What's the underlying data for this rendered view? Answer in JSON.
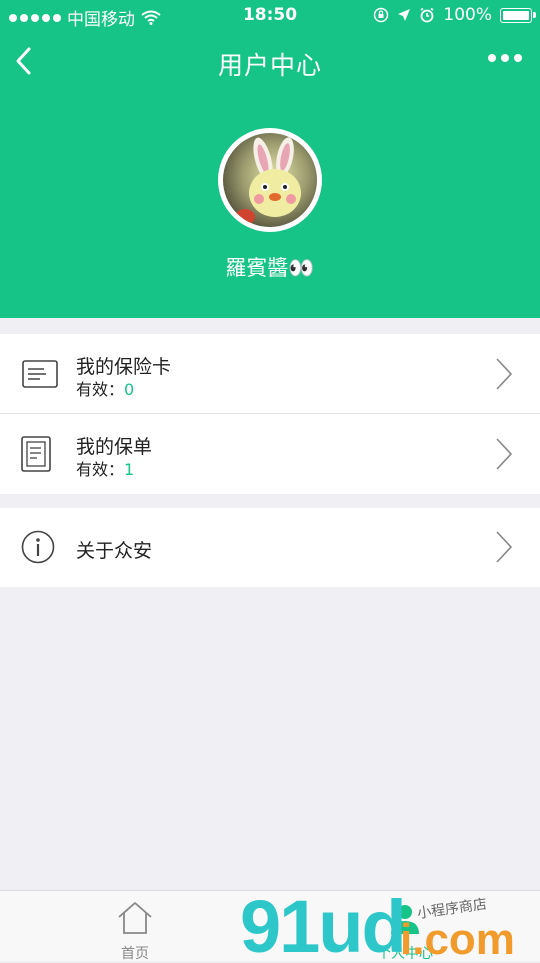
{
  "status_bar": {
    "carrier": "中国移动",
    "time": "18:50",
    "battery": "100%"
  },
  "nav": {
    "title": "用户中心"
  },
  "profile": {
    "username": "羅賓醬👀"
  },
  "menu": {
    "items": [
      {
        "title": "我的保险卡",
        "sub_label": "有效：",
        "sub_value": "0",
        "icon": "card-icon"
      },
      {
        "title": "我的保单",
        "sub_label": "有效：",
        "sub_value": "1",
        "icon": "document-icon"
      }
    ],
    "about": {
      "title": "关于众安",
      "icon": "info-icon"
    }
  },
  "tabbar": {
    "tabs": [
      {
        "label": "首页",
        "icon": "home-icon"
      },
      {
        "label": "个人中心",
        "icon": "user-icon",
        "active": true
      }
    ]
  },
  "watermark": {
    "text": "91ud",
    "suffix": "i.com",
    "tagline": "小程序商店"
  },
  "colors": {
    "brand": "#16c487",
    "watermark_cyan": "#2ec7c9",
    "watermark_orange": "#f19b2c"
  }
}
